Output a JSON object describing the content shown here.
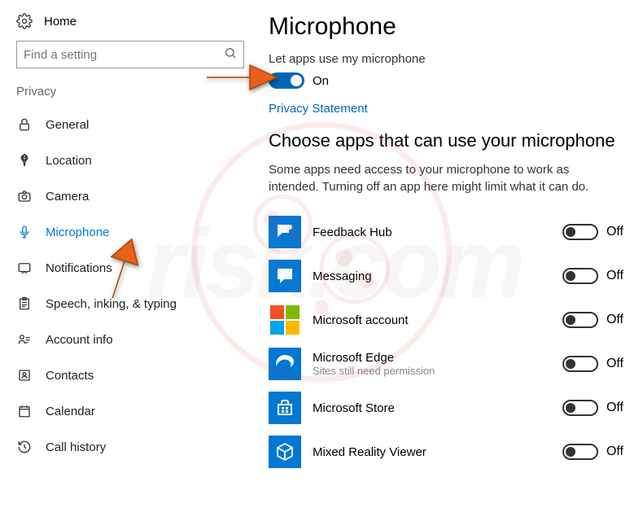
{
  "home_label": "Home",
  "search": {
    "placeholder": "Find a setting"
  },
  "section": "Privacy",
  "nav": [
    {
      "label": "General"
    },
    {
      "label": "Location"
    },
    {
      "label": "Camera"
    },
    {
      "label": "Microphone"
    },
    {
      "label": "Notifications"
    },
    {
      "label": "Speech, inking, & typing"
    },
    {
      "label": "Account info"
    },
    {
      "label": "Contacts"
    },
    {
      "label": "Calendar"
    },
    {
      "label": "Call history"
    }
  ],
  "page_title": "Microphone",
  "master_label": "Let apps use my microphone",
  "master_state": "On",
  "privacy_link": "Privacy Statement",
  "choose_heading": "Choose apps that can use your microphone",
  "choose_desc": "Some apps need access to your microphone to work as intended. Turning off an app here might limit what it can do.",
  "off_text": "Off",
  "apps": [
    {
      "name": "Feedback Hub",
      "sub": ""
    },
    {
      "name": "Messaging",
      "sub": ""
    },
    {
      "name": "Microsoft account",
      "sub": ""
    },
    {
      "name": "Microsoft Edge",
      "sub": "Sites still need permission"
    },
    {
      "name": "Microsoft Store",
      "sub": ""
    },
    {
      "name": "Mixed Reality Viewer",
      "sub": ""
    }
  ]
}
